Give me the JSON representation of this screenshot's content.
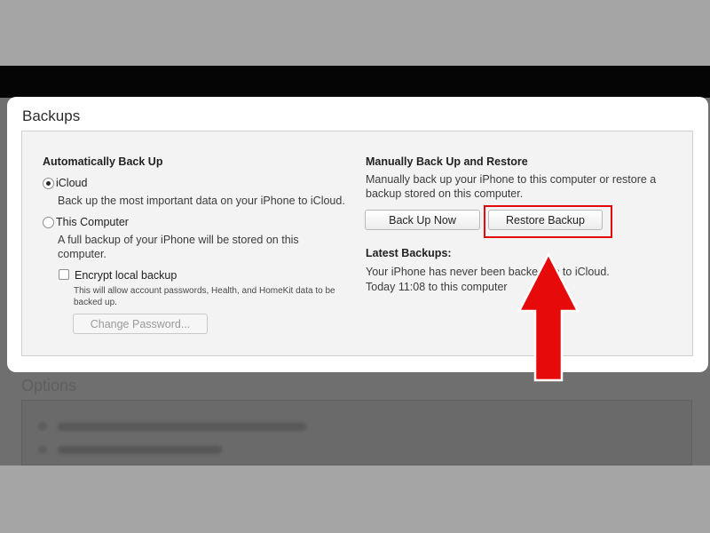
{
  "window": {
    "title": "Backups"
  },
  "auto_backup": {
    "heading": "Automatically Back Up",
    "icloud": {
      "label": "iCloud",
      "desc": "Back up the most important data on your iPhone to iCloud.",
      "selected": true
    },
    "this_computer": {
      "label": "This Computer",
      "desc": "A full backup of your iPhone will be stored on this computer.",
      "selected": false
    },
    "encrypt": {
      "label": "Encrypt local backup",
      "desc": "This will allow account passwords, Health, and HomeKit data to be backed up.",
      "checked": false
    },
    "change_password_label": "Change Password..."
  },
  "manual": {
    "heading": "Manually Back Up and Restore",
    "desc": "Manually back up your iPhone to this computer or restore a backup stored on this computer.",
    "back_up_now_label": "Back Up Now",
    "restore_backup_label": "Restore Backup"
  },
  "latest": {
    "heading": "Latest Backups:",
    "line1": "Your iPhone has never been backed up to iCloud.",
    "line2": "Today 11:08 to this computer"
  },
  "options": {
    "title": "Options"
  },
  "colors": {
    "annotation": "#e10b0b",
    "top_bar": "#050505"
  }
}
